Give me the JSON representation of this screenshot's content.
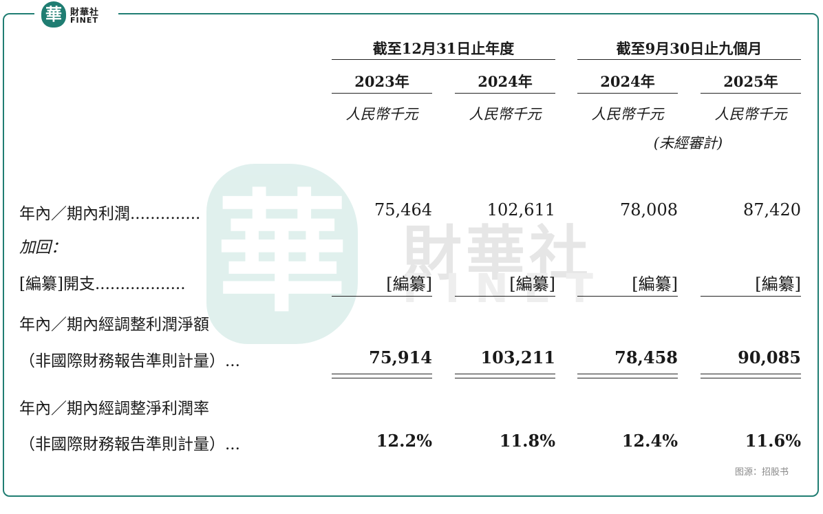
{
  "brand": {
    "mark": "華",
    "name_cn": "財華社",
    "name_en": "FINET"
  },
  "watermark": {
    "mark": "華",
    "name_cn": "財華社",
    "name_en": "FINET"
  },
  "header": {
    "groups": [
      "截至12月31日止年度",
      "截至9月30日止九個月"
    ],
    "years": [
      "2023年",
      "2024年",
      "2024年",
      "2025年"
    ],
    "unit": "人民幣千元",
    "unaudited_note": "(未經審計)"
  },
  "rows": {
    "profit": {
      "label": "年內／期內利潤..............",
      "values": [
        "75,464",
        "102,611",
        "78,008",
        "87,420"
      ]
    },
    "addback": {
      "label": "加回："
    },
    "expense": {
      "label": "[編纂]開支..................",
      "values": [
        "[編纂]",
        "[編纂]",
        "[編纂]",
        "[編纂]"
      ]
    },
    "adj_profit": {
      "label_line1": "年內／期內經調整利潤淨額",
      "label_line2": "（非國際財務報告準則計量）...",
      "values": [
        "75,914",
        "103,211",
        "78,458",
        "90,085"
      ]
    },
    "adj_margin": {
      "label_line1": "年內／期內經調整淨利潤率",
      "label_line2": "（非國際財務報告準則計量）...",
      "values": [
        "12.2%",
        "11.8%",
        "12.4%",
        "11.6%"
      ]
    }
  },
  "source": "图源：招股书"
}
